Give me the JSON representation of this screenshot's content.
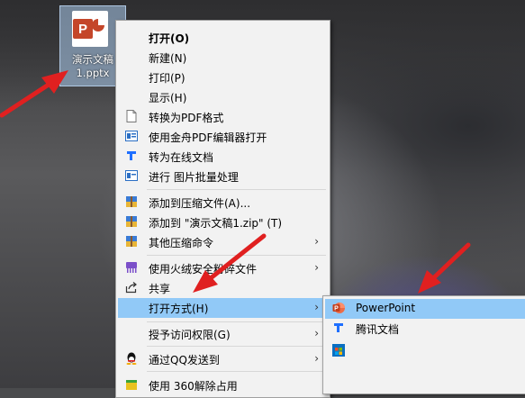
{
  "desktop": {
    "file_label_line1": "演示文稿",
    "file_label_line2": "1.pptx",
    "file_badge": "P"
  },
  "context_menu": {
    "items": [
      {
        "label": "打开(O)",
        "icon": "none",
        "bold": true
      },
      {
        "label": "新建(N)",
        "icon": "none"
      },
      {
        "label": "打印(P)",
        "icon": "none"
      },
      {
        "label": "显示(H)",
        "icon": "none"
      },
      {
        "label": "转换为PDF格式",
        "icon": "document-icon"
      },
      {
        "label": "使用金舟PDF编辑器打开",
        "icon": "pdf-editor-icon"
      },
      {
        "label": "转为在线文档",
        "icon": "tencent-docs-icon"
      },
      {
        "label": "进行 图片批量处理",
        "icon": "image-batch-icon"
      },
      {
        "label": "添加到压缩文件(A)...",
        "icon": "archive-icon"
      },
      {
        "label": "添加到 \"演示文稿1.zip\" (T)",
        "icon": "archive-icon"
      },
      {
        "label": "其他压缩命令",
        "icon": "archive-icon",
        "submenu": true
      },
      {
        "label": "使用火绒安全粉碎文件",
        "icon": "shredder-icon",
        "submenu": true
      },
      {
        "label": "共享",
        "icon": "share-icon"
      },
      {
        "label": "打开方式(H)",
        "icon": "none",
        "submenu": true,
        "highlighted": true
      },
      {
        "label": "授予访问权限(G)",
        "icon": "none",
        "submenu": true
      },
      {
        "label": "通过QQ发送到",
        "icon": "qq-icon",
        "submenu": true
      },
      {
        "label": "使用 360解除占用",
        "icon": "360-icon"
      }
    ],
    "submenu_arrow": "›"
  },
  "open_with_submenu": {
    "items": [
      {
        "label": "PowerPoint",
        "icon": "powerpoint-icon",
        "highlighted": true
      },
      {
        "label": "腾讯文档",
        "icon": "tencent-docs-icon"
      },
      {
        "label": "",
        "icon": "store-icon"
      }
    ]
  },
  "colors": {
    "menu_bg": "#f2f2f2",
    "highlight": "#91c9f7",
    "arrow_red": "#e02020",
    "ppt_orange": "#c4462a"
  }
}
